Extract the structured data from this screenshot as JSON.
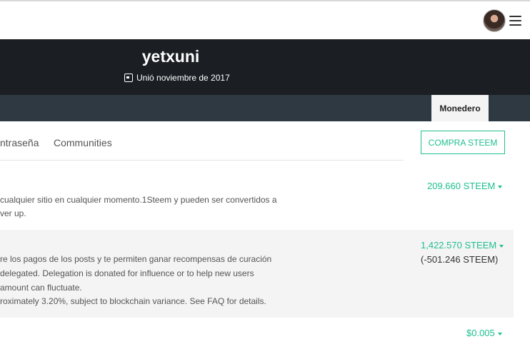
{
  "header": {
    "avatar_icon": "user-avatar",
    "menu_icon": "hamburger-menu-icon"
  },
  "profile": {
    "name": "yetxuni",
    "joined": "Unió noviembre de 2017",
    "joined_icon": "calendar-icon"
  },
  "tabs": {
    "wallet": "Monedero"
  },
  "subnav": {
    "items": [
      "ntraseña",
      "Communities"
    ]
  },
  "actions": {
    "buy": "COMPRA STEEM"
  },
  "balances": {
    "steem": {
      "desc_lines": [
        "cualquier sitio en cualquier momento.1Steem y pueden ser convertidos a",
        "ver up."
      ],
      "amount": "209.660 STEEM"
    },
    "steem_power": {
      "desc_lines": [
        "re los pagos de los posts y te permiten ganar recompensas de curación",
        "delegated. Delegation is donated for influence or to help new users",
        "amount can fluctuate.",
        "roximately 3.20%, subject to blockchain variance. See FAQ for details."
      ],
      "amount": "1,422.570 STEEM",
      "delegated": "(-501.246 STEEM)"
    },
    "steem_dollars": {
      "amount": "$0.005"
    }
  },
  "colors": {
    "accent": "#1fbf8f",
    "hero_bg": "#1b1f24",
    "tabbar_bg": "#2f3942"
  }
}
